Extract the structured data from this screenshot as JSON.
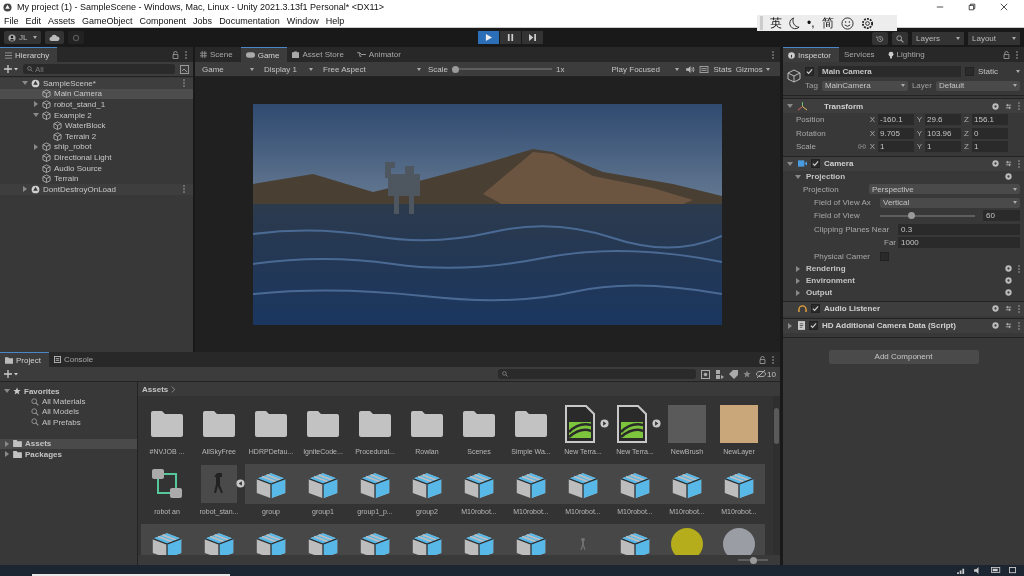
{
  "window": {
    "title": "My project (1) - SampleScene - Windows, Mac, Linux - Unity 2021.3.13f1 Personal* <DX11>"
  },
  "menu": [
    "File",
    "Edit",
    "Assets",
    "GameObject",
    "Component",
    "Jobs",
    "Documentation",
    "Window",
    "Help"
  ],
  "toolbar": {
    "account": "JL",
    "play_buttons": [
      {
        "kind": "play",
        "selected": true
      },
      {
        "kind": "pause",
        "selected": false
      },
      {
        "kind": "step",
        "selected": false
      }
    ],
    "layers": "Layers",
    "layout": "Layout"
  },
  "ime_bar": {
    "language": "英",
    "punctuation": "•,",
    "script": "简"
  },
  "hierarchy": {
    "title": "Hierarchy",
    "search_placeholder": "All",
    "tree": [
      {
        "label": "SampleScene*",
        "kind": "scene",
        "expanded": true,
        "selected": false,
        "children": [
          {
            "label": "Main Camera",
            "selected": true
          },
          {
            "label": "robot_stand_1",
            "expanded": false,
            "selected": false
          },
          {
            "label": "Example 2",
            "expanded": true,
            "selected": false,
            "children": [
              {
                "label": "WaterBlock",
                "selected": false
              },
              {
                "label": "Terrain 2",
                "selected": false
              }
            ]
          },
          {
            "label": "ship_robot",
            "expanded": false,
            "selected": false
          },
          {
            "label": "Directional Light",
            "selected": false
          },
          {
            "label": "Audio Source",
            "selected": false
          },
          {
            "label": "Terrain",
            "selected": false
          }
        ]
      },
      {
        "label": "DontDestroyOnLoad",
        "kind": "scene",
        "expanded": false,
        "selected": false
      }
    ]
  },
  "view": {
    "tabs": [
      {
        "label": "Scene",
        "kind": "scene",
        "selected": false
      },
      {
        "label": "Game",
        "kind": "game",
        "selected": true
      },
      {
        "label": "Asset Store",
        "kind": "store",
        "selected": false
      },
      {
        "label": "Animator",
        "kind": "animator",
        "selected": false
      }
    ],
    "game_toolbar": {
      "mode": "Game",
      "display": "Display 1",
      "aspect": "Free Aspect",
      "scale_label": "Scale",
      "scale": {
        "level": 0.03
      },
      "scale_value": "1x",
      "play_mode": "Play Focused",
      "stats": "Stats",
      "gizmos": "Gizmos"
    }
  },
  "inspector": {
    "tabs": [
      {
        "label": "Inspector",
        "kind": "info",
        "selected": true
      },
      {
        "label": "Services",
        "kind": "plain",
        "selected": false
      },
      {
        "label": "Lighting",
        "kind": "bulb",
        "selected": false
      }
    ],
    "object": {
      "active": true,
      "name": "Main Camera",
      "static": false,
      "static_label": "Static",
      "tag_label": "Tag",
      "tag": "MainCamera",
      "layer_label": "Layer",
      "layer": "Default"
    },
    "components": [
      {
        "kind": "transform",
        "title": "Transform",
        "expanded": true,
        "rows": [
          {
            "label": "Position",
            "constrained": false,
            "values": [
              {
                "axis": "X",
                "value": "-160.1"
              },
              {
                "axis": "Y",
                "value": "29.6"
              },
              {
                "axis": "Z",
                "value": "156.1"
              }
            ]
          },
          {
            "label": "Rotation",
            "constrained": false,
            "values": [
              {
                "axis": "X",
                "value": "9.705"
              },
              {
                "axis": "Y",
                "value": "103.96"
              },
              {
                "axis": "Z",
                "value": "0"
              }
            ]
          },
          {
            "label": "Scale",
            "constrained": true,
            "values": [
              {
                "axis": "X",
                "value": "1"
              },
              {
                "axis": "Y",
                "value": "1"
              },
              {
                "axis": "Z",
                "value": "1"
              }
            ]
          }
        ]
      },
      {
        "kind": "camera",
        "title": "Camera",
        "enabled": true,
        "expanded": true,
        "sections": [
          {
            "label": "Projection",
            "expanded": true,
            "menu_button": false,
            "fields": [
              {
                "kind": "dropdown",
                "label": "Projection",
                "value": "Perspective",
                "children": [
                  {
                    "kind": "dropdown",
                    "label": "Field of View Ax",
                    "value": "Vertical"
                  },
                  {
                    "kind": "slider",
                    "label": "Field of View",
                    "level": 0.33,
                    "value": "60"
                  },
                  {
                    "kind": "number",
                    "label": "Clipping Planes Near",
                    "value": "0.3"
                  },
                  {
                    "kind": "number-right",
                    "label": "Far",
                    "value": "1000"
                  },
                  {
                    "kind": "checkbox",
                    "label": "Physical Camer",
                    "checked": false
                  }
                ]
              }
            ]
          },
          {
            "label": "Rendering",
            "expanded": false,
            "menu_button": true
          },
          {
            "label": "Environment",
            "expanded": false,
            "menu_button": false
          },
          {
            "label": "Output",
            "expanded": false,
            "menu_button": false
          }
        ]
      },
      {
        "kind": "audio",
        "title": "Audio Listener",
        "enabled": true
      },
      {
        "kind": "script",
        "title": "HD Additional Camera Data (Script)",
        "enabled": true,
        "expanded": false
      }
    ],
    "add_component": "Add Component"
  },
  "project": {
    "tabs": [
      {
        "label": "Project",
        "kind": "folder",
        "selected": true
      },
      {
        "label": "Console",
        "kind": "console",
        "selected": false
      }
    ],
    "hidden_count": "10",
    "tree": [
      {
        "label": "Favorites",
        "kind": "favorites",
        "expanded": true,
        "selected": false,
        "children": [
          {
            "label": "All Materials",
            "kind": "search",
            "selected": false
          },
          {
            "label": "All Models",
            "kind": "search",
            "selected": false
          },
          {
            "label": "All Prefabs",
            "kind": "search",
            "selected": false
          }
        ]
      },
      {
        "label": "Assets",
        "kind": "folder",
        "expanded": false,
        "selected": true
      },
      {
        "label": "Packages",
        "kind": "folder",
        "expanded": false,
        "selected": false
      }
    ],
    "breadcrumb": "Assets",
    "asset_rows": [
      [
        {
          "kind": "folder",
          "label": "#NVJOB ...",
          "sub_asset": false
        },
        {
          "kind": "folder",
          "label": "AllSkyFree",
          "sub_asset": false
        },
        {
          "kind": "folder",
          "label": "HDRPDefau...",
          "sub_asset": false
        },
        {
          "kind": "folder",
          "label": "IgniteCode...",
          "sub_asset": false
        },
        {
          "kind": "folder",
          "label": "Procedural...",
          "sub_asset": false
        },
        {
          "kind": "folder",
          "label": "Rowlan",
          "sub_asset": false
        },
        {
          "kind": "folder",
          "label": "Scenes",
          "sub_asset": false
        },
        {
          "kind": "folder",
          "label": "Simple Wa...",
          "sub_asset": false
        },
        {
          "kind": "terrain",
          "label": "New Terra...",
          "expanded": false,
          "sub_asset": false
        },
        {
          "kind": "terrain",
          "label": "New Terra...",
          "expanded": false,
          "sub_asset": false
        },
        {
          "kind": "texture",
          "label": "NewBrush",
          "color": "#5a5a5a",
          "sub_asset": false
        },
        {
          "kind": "texture",
          "label": "NewLayer",
          "color": "#c9a77a",
          "sub_asset": false
        }
      ],
      [
        {
          "kind": "animator",
          "label": "robot an",
          "sub_asset": false
        },
        {
          "kind": "model",
          "label": "robot_stan...",
          "expanded": true,
          "sub_asset": false
        },
        {
          "kind": "prefab",
          "label": "group",
          "sub_asset": true
        },
        {
          "kind": "prefab",
          "label": "group1",
          "sub_asset": true
        },
        {
          "kind": "prefab",
          "label": "group1_p...",
          "sub_asset": true
        },
        {
          "kind": "prefab",
          "label": "group2",
          "sub_asset": true
        },
        {
          "kind": "prefab",
          "label": "M10robot...",
          "sub_asset": true
        },
        {
          "kind": "prefab",
          "label": "M10robot...",
          "sub_asset": true
        },
        {
          "kind": "prefab",
          "label": "M10robot...",
          "sub_asset": true
        },
        {
          "kind": "prefab",
          "label": "M10robot...",
          "sub_asset": true
        },
        {
          "kind": "prefab",
          "label": "M10robot...",
          "sub_asset": true
        },
        {
          "kind": "prefab",
          "label": "M10robot...",
          "sub_asset": true
        }
      ],
      [
        {
          "kind": "prefab",
          "sub_asset": true
        },
        {
          "kind": "prefab",
          "sub_asset": true
        },
        {
          "kind": "prefab",
          "sub_asset": true
        },
        {
          "kind": "prefab",
          "sub_asset": true
        },
        {
          "kind": "prefab",
          "sub_asset": true
        },
        {
          "kind": "prefab",
          "sub_asset": true
        },
        {
          "kind": "prefab",
          "sub_asset": true
        },
        {
          "kind": "prefab",
          "sub_asset": true
        },
        {
          "kind": "mesh",
          "sub_asset": true
        },
        {
          "kind": "prefab",
          "sub_asset": true
        },
        {
          "kind": "material",
          "color": "#b5ad1c",
          "sub_asset": true
        },
        {
          "kind": "material",
          "color": "#9a9ea4",
          "sub_asset": true
        }
      ]
    ],
    "thumbnail_size": {
      "level": 0.5
    }
  }
}
